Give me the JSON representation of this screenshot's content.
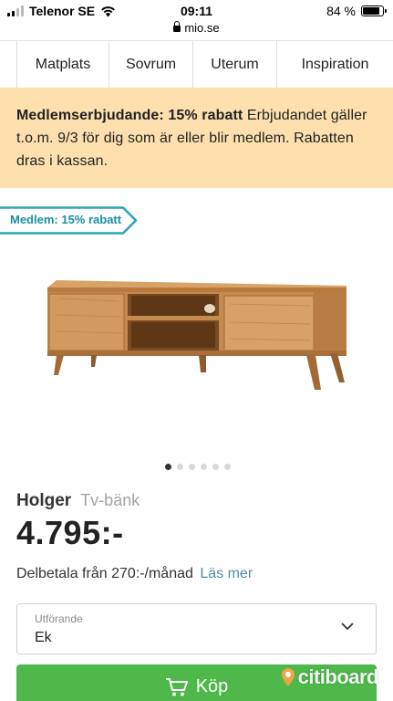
{
  "status_bar": {
    "carrier": "Telenor SE",
    "time": "09:11",
    "url": "mio.se",
    "battery": "84 %",
    "battery_level": 0.84
  },
  "nav": {
    "tabs": [
      {
        "label": "Matplats"
      },
      {
        "label": "Sovrum"
      },
      {
        "label": "Uterum"
      },
      {
        "label": "Inspiration"
      }
    ]
  },
  "promo": {
    "bold": "Medlemserbjudande: 15% rabatt",
    "text": " Erbjudandet gäller t.o.m. 9/3 för dig som är eller blir medlem. Rabatten dras i kassan."
  },
  "member_tag": "Medlem: 15% rabatt",
  "carousel": {
    "count": 6,
    "active": 0
  },
  "product": {
    "name": "Holger",
    "type": "Tv-bänk",
    "price": "4.795:-",
    "installment": "Delbetala från 270:-/månad",
    "read_more": "Läs mer"
  },
  "variant": {
    "label": "Utförande",
    "value": "Ek"
  },
  "buy_button": "Köp",
  "watermark": "citiboard",
  "colors": {
    "promo_bg": "#fde0ae",
    "accent_teal": "#1a8fa0",
    "buy_green": "#4fb84a",
    "link_blue": "#4a8fa7"
  }
}
